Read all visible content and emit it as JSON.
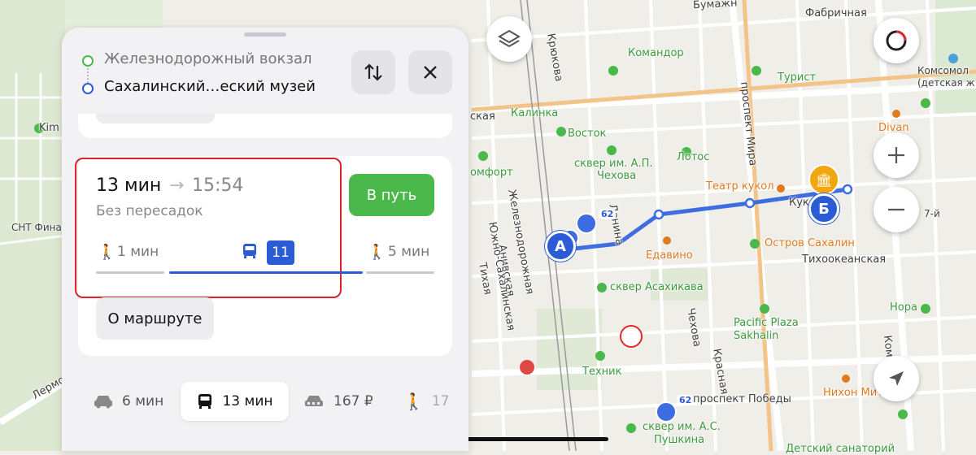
{
  "map": {
    "labels": {
      "bumazh": "Бумажн",
      "fabrichnaya": "Фабричная",
      "kryukova": "Крюкова",
      "komandor": "Командор",
      "turist": "Турист",
      "komsomolsk": "Комсомол",
      "komsomolsk2": "(детская ж",
      "kalinka": "Калинка",
      "kaya": "ская",
      "prospekt_mira": "проспект Мира",
      "vostok": "Восток",
      "divan": "Divan",
      "kim": "Kim",
      "lotos": "Лотос",
      "komfort": "омфорт",
      "skver_chekhova_1": "сквер им. А.П.",
      "skver_chekhova_2": "Чехова",
      "teatr_kukol": "Театр кукол",
      "kukla": "Кукла",
      "seven": "7-й",
      "zheleznodorozhnaya": "Железнодорожная",
      "lenina": "Ленина",
      "snt": "СНТ Фина",
      "aniva": "Анивская",
      "yuzhno": "Южно-Сахалинская",
      "tikhaya": "Тихая",
      "edavino": "Едавино",
      "ostrov": "Остров Сахалин",
      "tikhookeanskaya": "Тихоокеанская",
      "skver_asakhikava": "сквер Асахикава",
      "chekhova": "Чехова",
      "nora": "Нора",
      "pacific_1": "Pacific Plaza",
      "pacific_2": "Sakhalin",
      "krasnaya": "Красная",
      "komm": "Ком",
      "lermont": "Лермо",
      "tekhnik": "Техник",
      "prospekt_pobedy": "проспект Победы",
      "nikhon": "Нихон Митай",
      "skver_pushkina_1": "сквер им. А.С.",
      "skver_pushkina_2": "Пушкина",
      "sanatoriy": "Детский санаторий"
    },
    "bus_route_number": "62",
    "bus_route_number_2": "62",
    "marker_a": "А",
    "marker_b": "Б",
    "colors": {
      "route": "#3d6de0",
      "marker": "#2c5bd6",
      "accent_green": "#4ab84a",
      "highlight_red": "#e0202a"
    }
  },
  "route_header": {
    "from": "Железнодорожный вокзал",
    "to": "Сахалинский…еский музей"
  },
  "route_option": {
    "duration": "13 мин",
    "arrival": "15:54",
    "transfers": "Без пересадок",
    "walk_start": "1 мин",
    "bus_number": "11",
    "walk_end": "5 мин",
    "go_button": "В путь",
    "details_button": "О маршруте"
  },
  "modes": [
    {
      "icon": "car-icon",
      "label": "6 мин"
    },
    {
      "icon": "bus-icon",
      "label": "13 мин"
    },
    {
      "icon": "taxi-icon",
      "label": "167 ₽"
    },
    {
      "icon": "walk-icon",
      "label": "17"
    }
  ]
}
